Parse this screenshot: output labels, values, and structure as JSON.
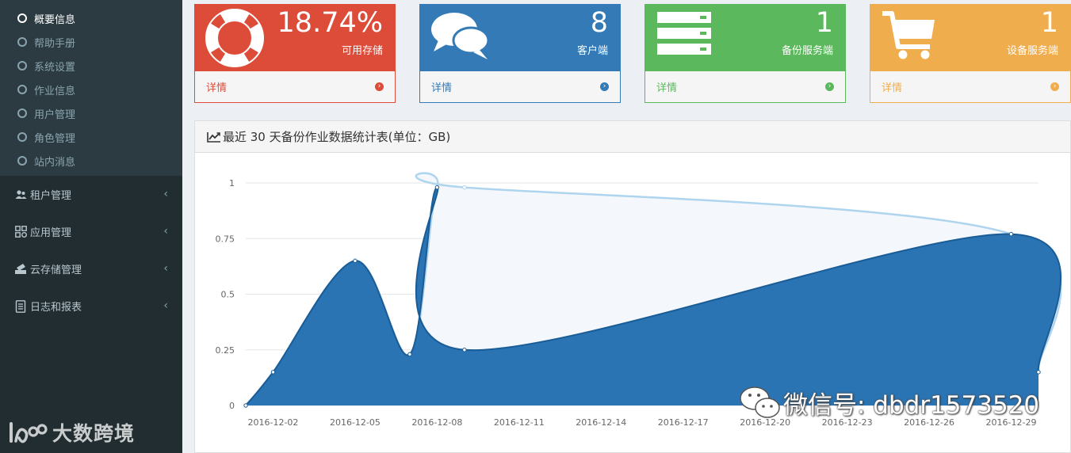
{
  "sidebar": {
    "subitems": [
      "概要信息",
      "帮助手册",
      "系统设置",
      "作业信息",
      "用户管理",
      "角色管理",
      "站内消息"
    ],
    "menus": [
      {
        "label": "租户管理",
        "icon": "users-icon"
      },
      {
        "label": "应用管理",
        "icon": "apps-icon"
      },
      {
        "label": "云存储管理",
        "icon": "cloud-storage-icon"
      },
      {
        "label": "日志和报表",
        "icon": "report-icon"
      }
    ],
    "chevron": "‹",
    "logo_text": "大数跨境"
  },
  "stats": [
    {
      "value": "18.74%",
      "label": "可用存储",
      "link": "详情",
      "color": "#dd4b39",
      "icon": "life-ring-icon"
    },
    {
      "value": "8",
      "label": "客户端",
      "link": "详情",
      "color": "#337ab7",
      "icon": "comments-icon"
    },
    {
      "value": "1",
      "label": "备份服务端",
      "link": "详情",
      "color": "#5cb85c",
      "icon": "server-icon"
    },
    {
      "value": "1",
      "label": "设备服务端",
      "link": "详情",
      "color": "#f0ad4e",
      "icon": "cart-icon"
    }
  ],
  "panel": {
    "title": "最近 30 天备份作业数据统计表(单位：GB)"
  },
  "chart_data": {
    "type": "area",
    "title": "最近 30 天备份作业数据统计表(单位：GB)",
    "x_ticks": [
      "2016-12-02",
      "2016-12-05",
      "2016-12-08",
      "2016-12-11",
      "2016-12-14",
      "2016-12-17",
      "2016-12-20",
      "2016-12-23",
      "2016-12-26",
      "2016-12-29"
    ],
    "y_ticks": [
      "0",
      "0.25",
      "0.5",
      "0.75",
      "1"
    ],
    "ylim": [
      0,
      1
    ],
    "series": [
      {
        "color": "#aed4ee",
        "values": [
          {
            "x": "2016-12-01",
            "y": 0
          },
          {
            "x": "2016-12-02",
            "y": 0.15
          },
          {
            "x": "2016-12-05",
            "y": 0.65
          },
          {
            "x": "2016-12-07",
            "y": 0.23
          },
          {
            "x": "2016-12-08",
            "y": 0.98
          },
          {
            "x": "2016-12-09",
            "y": 0.98
          },
          {
            "x": "2016-12-29",
            "y": 0.77
          },
          {
            "x": "2016-12-30",
            "y": 0.15
          }
        ]
      },
      {
        "color": "#2a74b4",
        "values": [
          {
            "x": "2016-12-01",
            "y": 0
          },
          {
            "x": "2016-12-02",
            "y": 0.15
          },
          {
            "x": "2016-12-05",
            "y": 0.65
          },
          {
            "x": "2016-12-07",
            "y": 0.23
          },
          {
            "x": "2016-12-08",
            "y": 0.98
          },
          {
            "x": "2016-12-09",
            "y": 0.25
          },
          {
            "x": "2016-12-29",
            "y": 0.77
          },
          {
            "x": "2016-12-30",
            "y": 0.15
          }
        ]
      }
    ],
    "grid": true
  },
  "watermark": "微信号: dbdr1573520"
}
